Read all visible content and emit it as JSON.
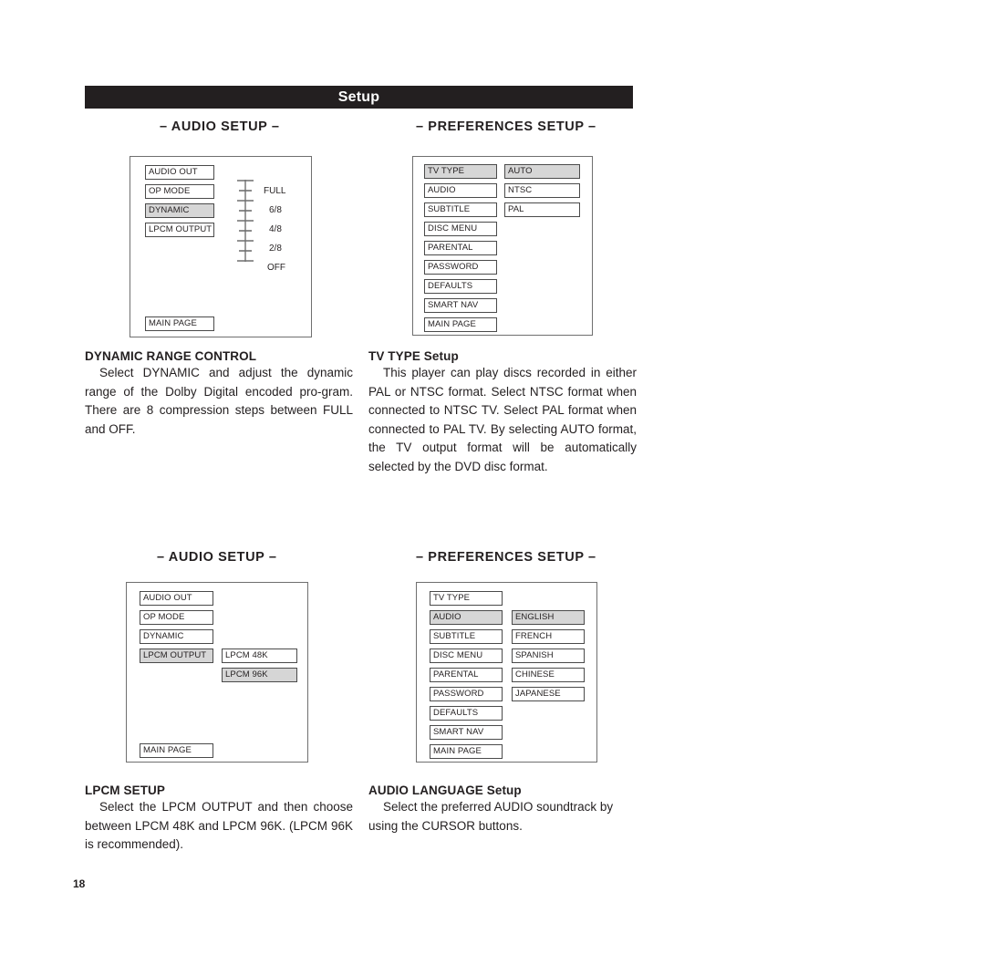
{
  "page": {
    "title": "Setup",
    "number": "18"
  },
  "headings": {
    "audio_setup": "– AUDIO SETUP –",
    "preferences_setup": "– PREFERENCES SETUP –"
  },
  "diagram_audio_dynamic": {
    "left_menu": [
      {
        "label": "AUDIO OUT",
        "selected": false
      },
      {
        "label": "OP MODE",
        "selected": false
      },
      {
        "label": "DYNAMIC",
        "selected": true
      },
      {
        "label": "LPCM OUTPUT",
        "selected": false
      }
    ],
    "main_page": "MAIN PAGE",
    "slider_labels": [
      "FULL",
      "6/8",
      "4/8",
      "2/8",
      "OFF"
    ]
  },
  "diagram_pref_tvtype": {
    "left_menu": [
      {
        "label": "TV TYPE",
        "selected": true
      },
      {
        "label": "AUDIO",
        "selected": false
      },
      {
        "label": "SUBTITLE",
        "selected": false
      },
      {
        "label": "DISC MENU",
        "selected": false
      },
      {
        "label": "PARENTAL",
        "selected": false
      },
      {
        "label": "PASSWORD",
        "selected": false
      },
      {
        "label": "DEFAULTS",
        "selected": false
      },
      {
        "label": "SMART NAV",
        "selected": false
      },
      {
        "label": "MAIN PAGE",
        "selected": false
      }
    ],
    "right_menu": [
      {
        "label": "AUTO",
        "selected": true
      },
      {
        "label": "NTSC",
        "selected": false
      },
      {
        "label": "PAL",
        "selected": false
      }
    ]
  },
  "diagram_audio_lpcm": {
    "left_menu": [
      {
        "label": "AUDIO OUT",
        "selected": false
      },
      {
        "label": "OP MODE",
        "selected": false
      },
      {
        "label": "DYNAMIC",
        "selected": false
      },
      {
        "label": "LPCM OUTPUT",
        "selected": true
      }
    ],
    "right_menu": [
      {
        "label": "LPCM 48K",
        "selected": false
      },
      {
        "label": "LPCM 96K",
        "selected": true
      }
    ],
    "main_page": "MAIN PAGE"
  },
  "diagram_pref_audiolang": {
    "left_menu": [
      {
        "label": "TV TYPE",
        "selected": false
      },
      {
        "label": "AUDIO",
        "selected": true
      },
      {
        "label": "SUBTITLE",
        "selected": false
      },
      {
        "label": "DISC MENU",
        "selected": false
      },
      {
        "label": "PARENTAL",
        "selected": false
      },
      {
        "label": "PASSWORD",
        "selected": false
      },
      {
        "label": "DEFAULTS",
        "selected": false
      },
      {
        "label": "SMART NAV",
        "selected": false
      },
      {
        "label": "MAIN PAGE",
        "selected": false
      }
    ],
    "right_menu": [
      {
        "label": "ENGLISH",
        "selected": true
      },
      {
        "label": "FRENCH",
        "selected": false
      },
      {
        "label": "SPANISH",
        "selected": false
      },
      {
        "label": "CHINESE",
        "selected": false
      },
      {
        "label": "JAPANESE",
        "selected": false
      }
    ]
  },
  "copy": {
    "dynamic_range": {
      "heading": "DYNAMIC RANGE CONTROL",
      "body": "Select DYNAMIC and adjust the dynamic range of the Dolby Digital encoded pro-gram. There are 8 compression steps between FULL and OFF."
    },
    "tv_type": {
      "heading": "TV TYPE Setup",
      "body": "This player can play discs recorded in either PAL or NTSC format. Select NTSC format when connected to NTSC TV. Select PAL format when connected to PAL TV. By selecting AUTO format, the TV output format will be automatically selected by the DVD disc format."
    },
    "lpcm_setup": {
      "heading": "LPCM SETUP",
      "body": "Select the LPCM OUTPUT and then choose between LPCM 48K and LPCM 96K. (LPCM 96K is recommended)."
    },
    "audio_language": {
      "heading": "AUDIO LANGUAGE Setup",
      "body": "Select the preferred AUDIO soundtrack by using the CURSOR buttons."
    }
  },
  "colors": {
    "bar_background": "#231f20",
    "selected_item": "#d6d6d6",
    "text": "#231f20"
  }
}
